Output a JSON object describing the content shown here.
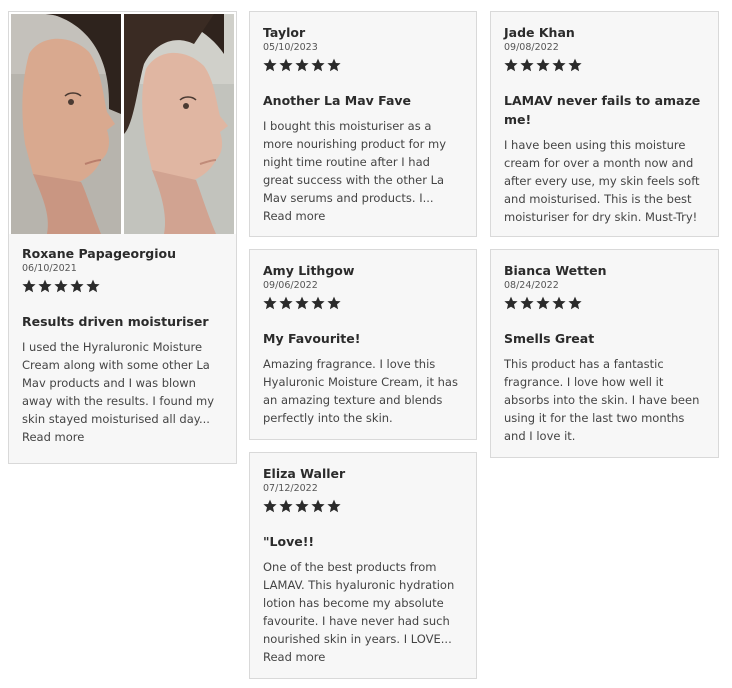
{
  "reviews": [
    {
      "author": "Roxane Papageorgiou",
      "date": "06/10/2021",
      "rating": 5,
      "title": "Results driven moisturiser",
      "text": "I used the Hyraluronic Moisture Cream along with some other La Mav products and I was blown away with the results. I found my skin stayed moisturised all day...",
      "read_more": "Read more"
    },
    {
      "author": "Taylor",
      "date": "05/10/2023",
      "rating": 5,
      "title": "Another La Mav Fave",
      "text": "I bought this moisturiser as a more nourishing product for my night time routine after I had great success with the other La Mav serums and products. I...",
      "read_more": "Read more"
    },
    {
      "author": "Jade Khan",
      "date": "09/08/2022",
      "rating": 5,
      "title": "LAMAV never fails to amaze me!",
      "text": "I have been using this moisture cream for over a month now and after every use, my skin feels soft and moisturised. This is the best moisturiser for dry skin. Must-Try!"
    },
    {
      "author": "Amy Lithgow",
      "date": "09/06/2022",
      "rating": 5,
      "title": "My Favourite!",
      "text": "Amazing fragrance. I love this Hyaluronic Moisture Cream, it has an amazing texture and blends perfectly into the skin."
    },
    {
      "author": "Bianca Wetten",
      "date": "08/24/2022",
      "rating": 5,
      "title": "Smells Great",
      "text": "This product has a fantastic fragrance. I love how well it absorbs into the skin. I have been using it for the last two months and I love it."
    },
    {
      "author": "Eliza Waller",
      "date": "07/12/2022",
      "rating": 5,
      "title": "\"Love!!",
      "text": "One of the best products from LAMAV. This hyaluronic hydration lotion has become my absolute favourite. I have never had such nourished skin in years. I LOVE...",
      "read_more": "Read more"
    }
  ],
  "colors": {
    "card_bg": "#f7f7f7",
    "card_border": "#d9d9d9",
    "star": "#2b2b2b",
    "text": "#444444"
  }
}
